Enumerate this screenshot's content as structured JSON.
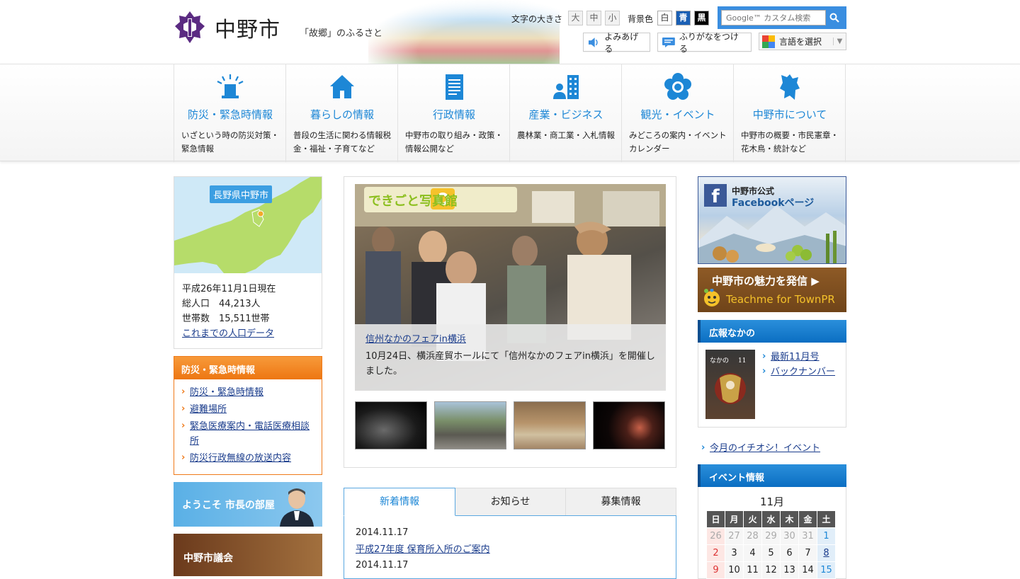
{
  "header": {
    "site_name": "中野市",
    "tagline": "「故郷」のふるさと",
    "text_size_label": "文字の大きさ",
    "text_sizes": [
      "大",
      "中",
      "小"
    ],
    "bg_color_label": "背景色",
    "bg_colors": [
      "白",
      "青",
      "黒"
    ],
    "search_placeholder": "Google™ カスタム検索",
    "read_aloud": "よみあげる",
    "furigana": "ふりがなをつける",
    "language": "言語を選択"
  },
  "nav": [
    {
      "title": "防災・緊急時情報",
      "desc": "いざという時の防災対策・緊急情報",
      "icon": "siren-icon"
    },
    {
      "title": "暮らしの情報",
      "desc": "普段の生活に関わる情報税金・福祉・子育てなど",
      "icon": "house-icon"
    },
    {
      "title": "行政情報",
      "desc": "中野市の取り組み・政策・情報公開など",
      "icon": "document-icon"
    },
    {
      "title": "産業・ビジネス",
      "desc": "農林業・商工業・入札情報",
      "icon": "business-icon"
    },
    {
      "title": "観光・イベント",
      "desc": "みどころの案内・イベントカレンダー",
      "icon": "flower-icon"
    },
    {
      "title": "中野市について",
      "desc": "中野市の概要・市民憲章・花木鳥・統計など",
      "icon": "city-map-icon"
    }
  ],
  "population": {
    "badge": "長野県中野市",
    "as_of": "平成26年11月1日現在",
    "total": "総人口　44,213人",
    "households": "世帯数　15,511世帯",
    "link": "これまでの人口データ"
  },
  "emergency": {
    "title": "防災・緊急時情報",
    "links": [
      "防災・緊急時情報",
      "避難場所",
      "緊急医療案内・電話医療相談所",
      "防災行政無線の放送内容"
    ]
  },
  "banners": {
    "mayor": "ようこそ 市長の部屋",
    "council": "中野市議会"
  },
  "photo": {
    "title_banner": "できごと写真館",
    "caption_link": "信州なかのフェアin横浜",
    "caption_text": "10月24日、横浜産貿ホールにて「信州なかのフェアin横浜」を開催しました。"
  },
  "tabs": {
    "items": [
      "新着情報",
      "お知らせ",
      "募集情報"
    ],
    "news": [
      {
        "date": "2014.11.17",
        "title": "平成27年度 保育所入所のご案内"
      },
      {
        "date": "2014.11.17",
        "title": ""
      }
    ]
  },
  "right": {
    "fb_line1": "中野市公式",
    "fb_line2": "Facebookページ",
    "teachme_line1": "中野市の魅力を発信 ▶",
    "teachme_line2": "Teachme for TownPR",
    "koho_title": "広報なかの",
    "koho_links": [
      "最新11月号",
      "バックナンバー"
    ],
    "ichioshi": "今月のイチオシ！イベント",
    "event_title": "イベント情報",
    "calendar": {
      "month": "11月",
      "weekdays": [
        "日",
        "月",
        "火",
        "水",
        "木",
        "金",
        "土"
      ],
      "rows": [
        [
          "26",
          "27",
          "28",
          "29",
          "30",
          "31",
          "1"
        ],
        [
          "2",
          "3",
          "4",
          "5",
          "6",
          "7",
          "8"
        ],
        [
          "9",
          "10",
          "11",
          "12",
          "13",
          "14",
          "15"
        ]
      ]
    }
  }
}
